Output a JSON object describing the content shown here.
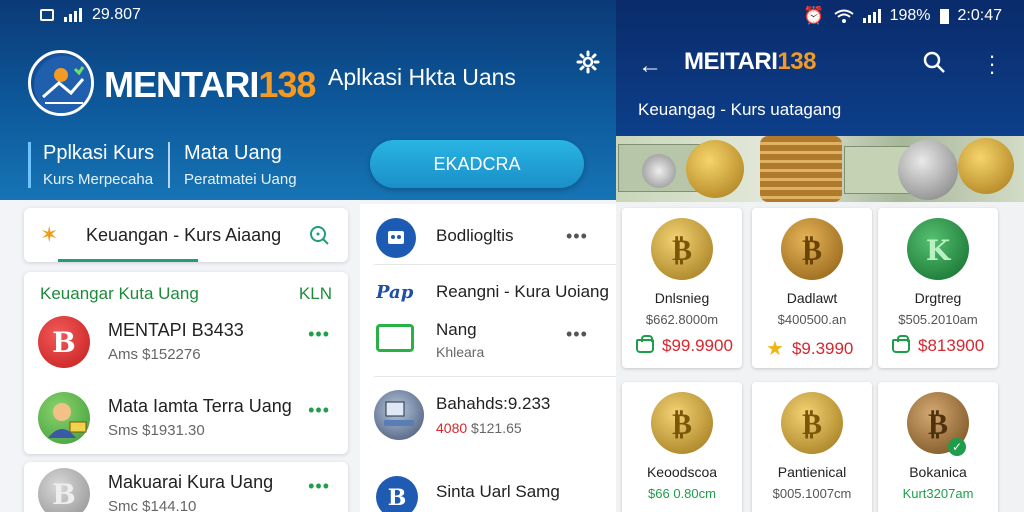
{
  "colors": {
    "primary_dark": "#0b3a78",
    "accent_orange": "#f39a23",
    "cta_blue": "#29b4e3",
    "green": "#1e9e4a",
    "price_red": "#d8262f"
  },
  "left": {
    "status_bar": {
      "time": "29.807"
    },
    "brand": {
      "name_main": "MENTARI",
      "name_num": "138",
      "tagline": "Aplkasi Hkta Uans"
    },
    "hero_tabs": [
      {
        "title": "Pplkasi Kurs",
        "subtitle": "Kurs Merpecaha"
      },
      {
        "title": "Mata Uang",
        "subtitle": "Peratmatei Uang"
      }
    ],
    "cta_label": "EKADCRA",
    "search": {
      "text": "Keuangan - Kurs Aiaang"
    },
    "list_header": {
      "title": "Keuangar Kuta Uang",
      "badge": "KLN"
    },
    "list_items": [
      {
        "title": "MENTAPI B3433",
        "subtitle": "Ams $152276",
        "dots": "•••"
      },
      {
        "title": "Mata Iamta Terra Uang",
        "subtitle": "Sms $1931.30",
        "dots": "•••"
      },
      {
        "title": "Makuarai Kura Uang",
        "subtitle": "Smc $144.10",
        "dots": "•••"
      }
    ],
    "mid_items": [
      {
        "title": "Bodliogltis",
        "subtitle": "",
        "more": "•••"
      },
      {
        "title": "Reangni - Kura Uoiang",
        "subtitle": "",
        "more": ""
      },
      {
        "title": "Nang",
        "subtitle": "Khleara",
        "more": "•••"
      },
      {
        "title": "Bahahds:9.233",
        "subtitle_red": "4080",
        "subtitle": "$121.65",
        "more": ""
      },
      {
        "title": "Sintа Uarl Samg",
        "subtitle": "",
        "more": ""
      }
    ]
  },
  "right": {
    "status_bar": {
      "battery": "198%",
      "time": "2:0:47"
    },
    "brand": {
      "name_main": "MEITARI",
      "name_num": "138"
    },
    "subtitle": "Keuangag - Kurs uatagang",
    "products": [
      {
        "name": "Dnlsnieg",
        "old_price": "$662.8000m",
        "new_price": "$99.9900",
        "icon": "shopping-bag-icon",
        "coin": "gold-bitcoin"
      },
      {
        "name": "Dadlawt",
        "old_price": "$400500.an",
        "new_price": "$9.3990",
        "icon": "star-icon",
        "coin": "bronze-bitcoin"
      },
      {
        "name": "Drgtreg",
        "old_price": "$505.2010am",
        "new_price": "$813900",
        "icon": "shopping-bag-icon",
        "coin": "green-coin"
      },
      {
        "name": "Keoodscoa",
        "old_price": "$66 0.80cm",
        "new_price": "",
        "icon": "",
        "coin": "gold-bitcoin"
      },
      {
        "name": "Pantienical",
        "old_price": "$005.1007cm",
        "new_price": "",
        "icon": "",
        "coin": "gold-bitcoin"
      },
      {
        "name": "Bokanica",
        "old_price": "Kurt3207am",
        "new_price": "",
        "icon": "",
        "coin": "bronze-bitcoin"
      }
    ]
  }
}
